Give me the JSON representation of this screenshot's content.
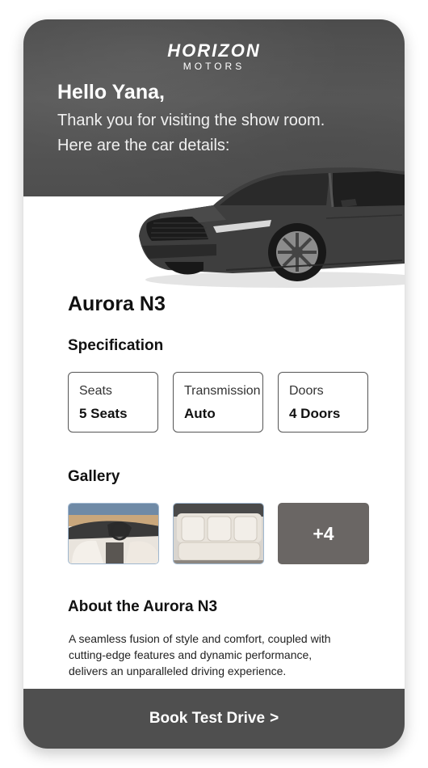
{
  "brand": {
    "name": "HORIZON",
    "sub": "MOTORS"
  },
  "greeting": "Hello Yana,",
  "intro": [
    "Thank you for visiting the show room.",
    "Here are the car details:"
  ],
  "car": {
    "model": "Aurora N3"
  },
  "specification": {
    "heading": "Specification",
    "items": [
      {
        "label": "Seats",
        "value": "5 Seats"
      },
      {
        "label": "Transmission",
        "value": "Auto"
      },
      {
        "label": "Doors",
        "value": "4 Doors"
      }
    ]
  },
  "gallery": {
    "heading": "Gallery",
    "more_count": "+4"
  },
  "about": {
    "heading": "About the Aurora N3",
    "lines": [
      "A seamless fusion of style and comfort, coupled with",
      "cutting-edge features and dynamic performance,",
      "delivers an unparalleled driving experience."
    ]
  },
  "cta": {
    "label": "Book Test Drive",
    "icon": "chevron-right-icon"
  },
  "colors": {
    "header_bg": "#4f4f4f",
    "button_bg": "#4f4f4f",
    "text": "#111111",
    "border": "#555555"
  }
}
